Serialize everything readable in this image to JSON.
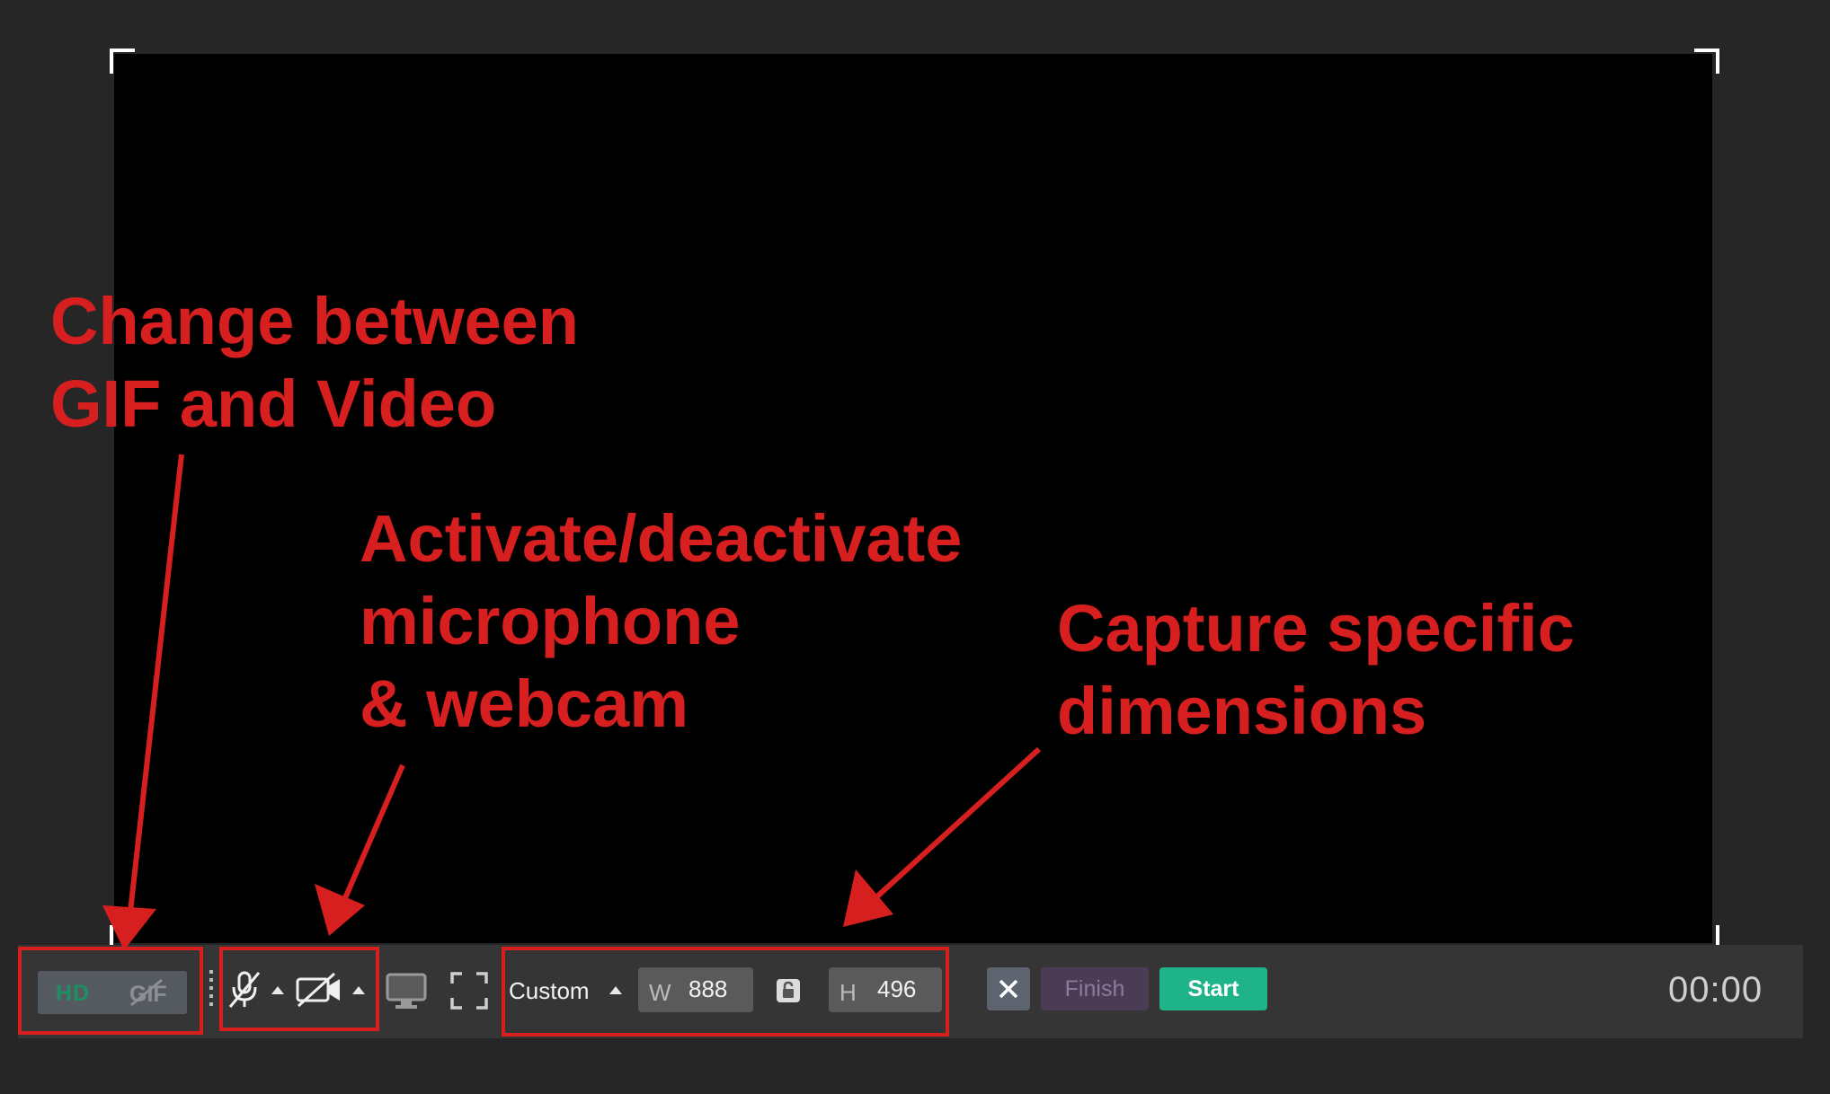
{
  "annotations": {
    "format": [
      "Change between",
      "GIF and Video"
    ],
    "media": [
      "Activate/deactivate",
      "microphone",
      "& webcam"
    ],
    "dimensions": [
      "Capture specific",
      "dimensions"
    ]
  },
  "toolbar": {
    "hd_label": "HD",
    "preset_label": "Custom",
    "width_prefix": "W",
    "width_value": "888",
    "height_prefix": "H",
    "height_value": "496",
    "finish_label": "Finish",
    "start_label": "Start",
    "timer": "00:00"
  },
  "colors": {
    "annotation": "#d71f1f",
    "start_button": "#1fb38a",
    "finish_button": "#4a3c55",
    "hd_text": "#1e8f62"
  },
  "icons": [
    "gif-off-icon",
    "mic-off-icon",
    "camera-off-icon",
    "monitor-icon",
    "fullscreen-icon",
    "lock-icon",
    "close-icon"
  ]
}
